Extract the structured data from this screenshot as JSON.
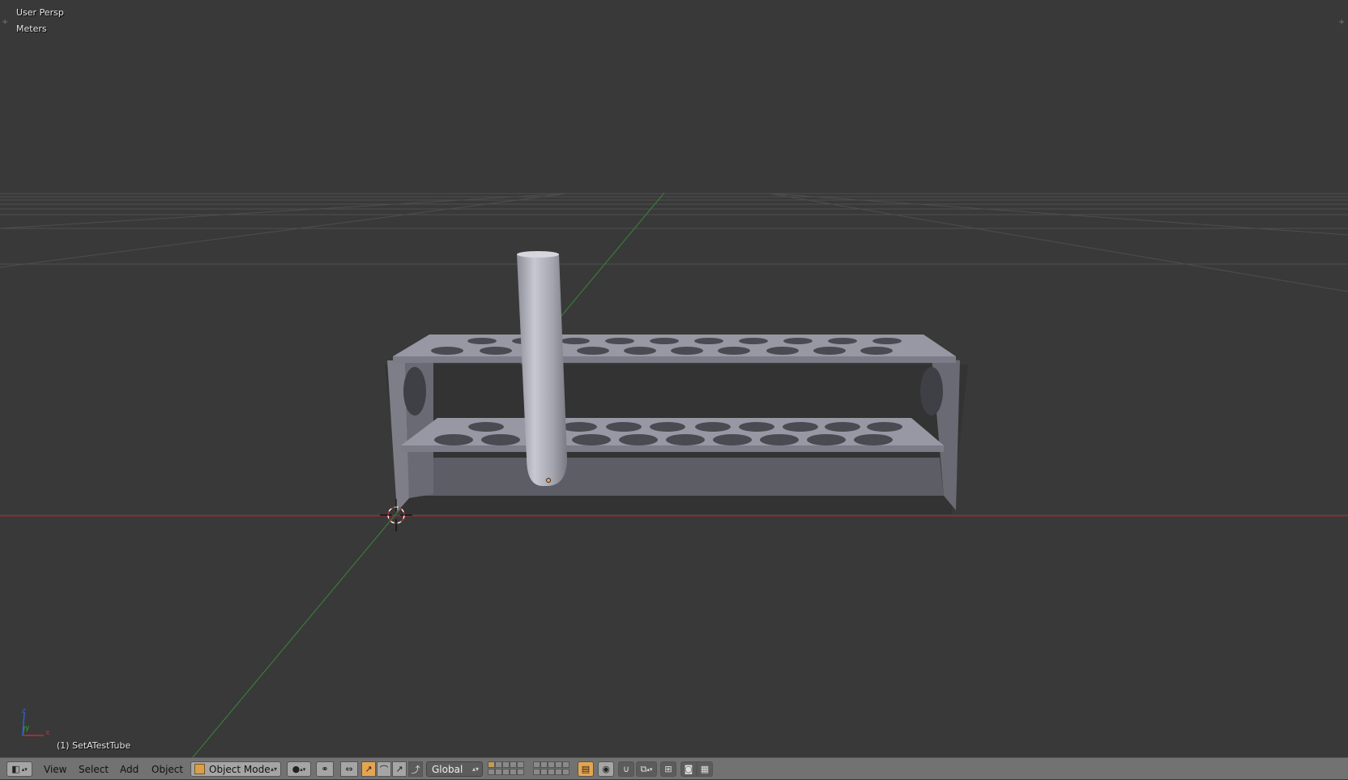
{
  "viewport": {
    "view_name": "User Persp",
    "units": "Meters",
    "active_object": "(1) SetATestTube"
  },
  "header": {
    "editor_type_icon": "3d-view-icon",
    "menus": [
      "View",
      "Select",
      "Add",
      "Object"
    ],
    "mode": "Object Mode",
    "orientation": "Global"
  },
  "colors": {
    "viewport_bg": "#393939",
    "grid_line": "#4c4c4c",
    "x_axis": "#9a2f2f",
    "y_axis": "#3d7f3d",
    "rack": "#9a9aa6",
    "header_bg": "#727272",
    "active_button": "#e5a550"
  }
}
